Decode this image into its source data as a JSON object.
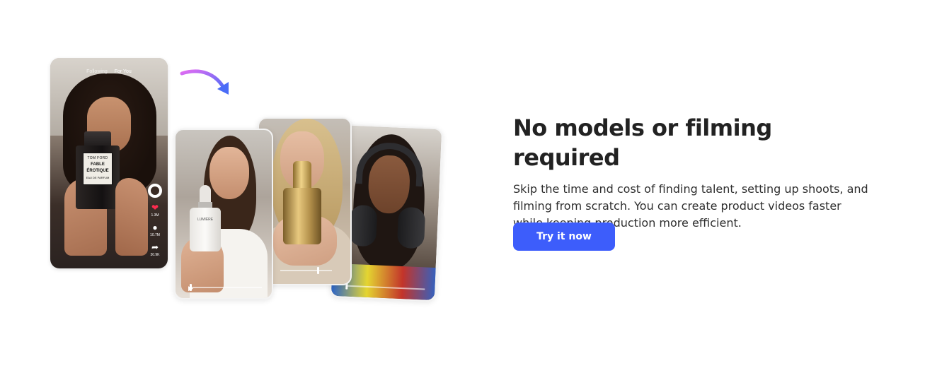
{
  "source_video": {
    "tab_following": "Following",
    "tab_for_you": "For You",
    "product": {
      "brand": "TOM FORD",
      "name_line1": "FABLE",
      "name_line2": "ÉROTIQUE",
      "sub": "EAU DE PARFUM"
    },
    "stats": {
      "likes": "1.3M",
      "comments": "10.7M",
      "shares": "30.9K"
    }
  },
  "generated_videos": {
    "card1_product_label": "LUMIÈRE"
  },
  "section": {
    "title": "No models or filming required",
    "description": "Skip the time and cost of finding talent, setting up shoots, and filming from scratch. You can create product videos faster while keeping production more efficient.",
    "cta_label": "Try it now"
  },
  "colors": {
    "cta_bg": "#3d5dfb",
    "arrow_gradient_start": "#e06cf2",
    "arrow_gradient_end": "#4a6cf7",
    "like_icon": "#ff2b4f"
  }
}
